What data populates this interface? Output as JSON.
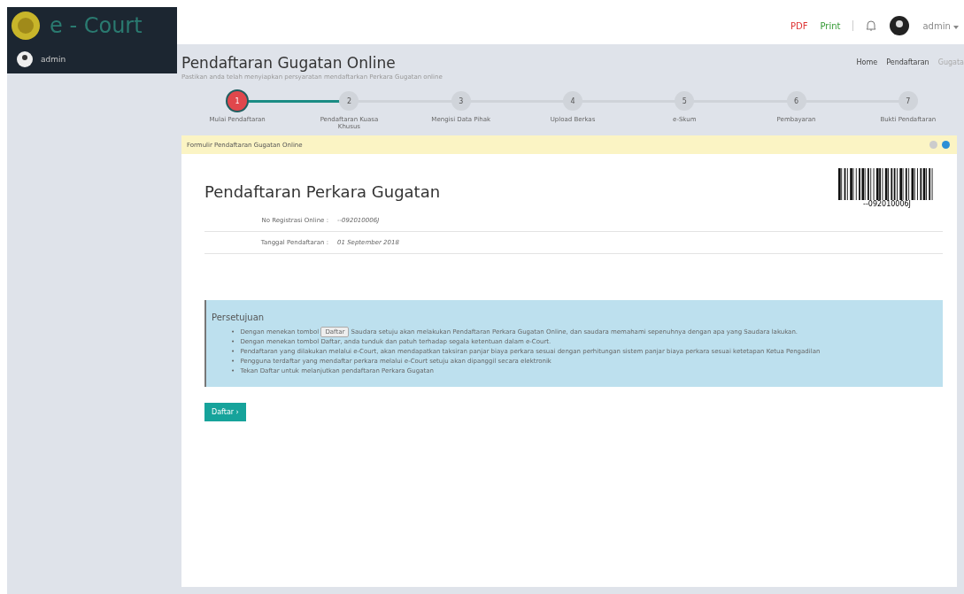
{
  "brand": {
    "logo": "e - Court"
  },
  "sidebar": {
    "user": "admin"
  },
  "topbar": {
    "pdf": "PDF",
    "print": "Print",
    "user": "admin"
  },
  "page": {
    "title": "Pendaftaran Gugatan Online",
    "subtitle": "Pastikan anda telah menyiapkan persyaratan mendaftarkan Perkara Gugatan online",
    "breadcrumb": [
      "Home",
      "Pendaftaran",
      "Gugata"
    ]
  },
  "steps": [
    {
      "number": "1",
      "label": "Mulai Pendaftaran",
      "selected": true
    },
    {
      "number": "2",
      "label": "Pendaftaran Kuasa Khusus",
      "selected": false
    },
    {
      "number": "3",
      "label": "Mengisi Data Pihak",
      "selected": false
    },
    {
      "number": "4",
      "label": "Upload Berkas",
      "selected": false
    },
    {
      "number": "5",
      "label": "e-Skum",
      "selected": false
    },
    {
      "number": "6",
      "label": "Pembayaran",
      "selected": false
    },
    {
      "number": "7",
      "label": "Bukti Pendaftaran",
      "selected": false
    }
  ],
  "panel": {
    "title": "Formulir Pendaftaran Gugatan Online",
    "heading": "Pendaftaran Perkara Gugatan",
    "barcode_text": "--092010006J",
    "fields": [
      {
        "label": "No Registrasi Online :",
        "value": "--092010006J"
      },
      {
        "label": "Tanggal Pendaftaran :",
        "value": "01 September 2018"
      }
    ],
    "agreement": {
      "title": "Persetujuan",
      "items": [
        {
          "marker": "•",
          "before": "Dengan menekan tombol",
          "button": "Daftar",
          "after": "Saudara setuju akan melakukan Pendaftaran Perkara Gugatan Online, dan saudara memahami sepenuhnya dengan apa yang Saudara lakukan."
        },
        {
          "marker": "•",
          "text": "Dengan menekan tombol Daftar, anda tunduk dan patuh terhadap segala ketentuan dalam e-Court."
        },
        {
          "marker": "•",
          "text": "Pendaftaran yang dilakukan melalui e-Court, akan mendapatkan taksiran panjar biaya perkara sesuai dengan perhitungan sistem panjar biaya perkara sesuai ketetapan Ketua Pengadilan"
        },
        {
          "marker": "•",
          "text": "Pengguna terdaftar yang mendaftar perkara melalui e-Court setuju akan dipanggil secara elektronik"
        },
        {
          "marker": "•",
          "text": "Tekan Daftar untuk melanjutkan pendaftaran Perkara Gugatan"
        }
      ]
    },
    "submit": "Daftar ›"
  }
}
